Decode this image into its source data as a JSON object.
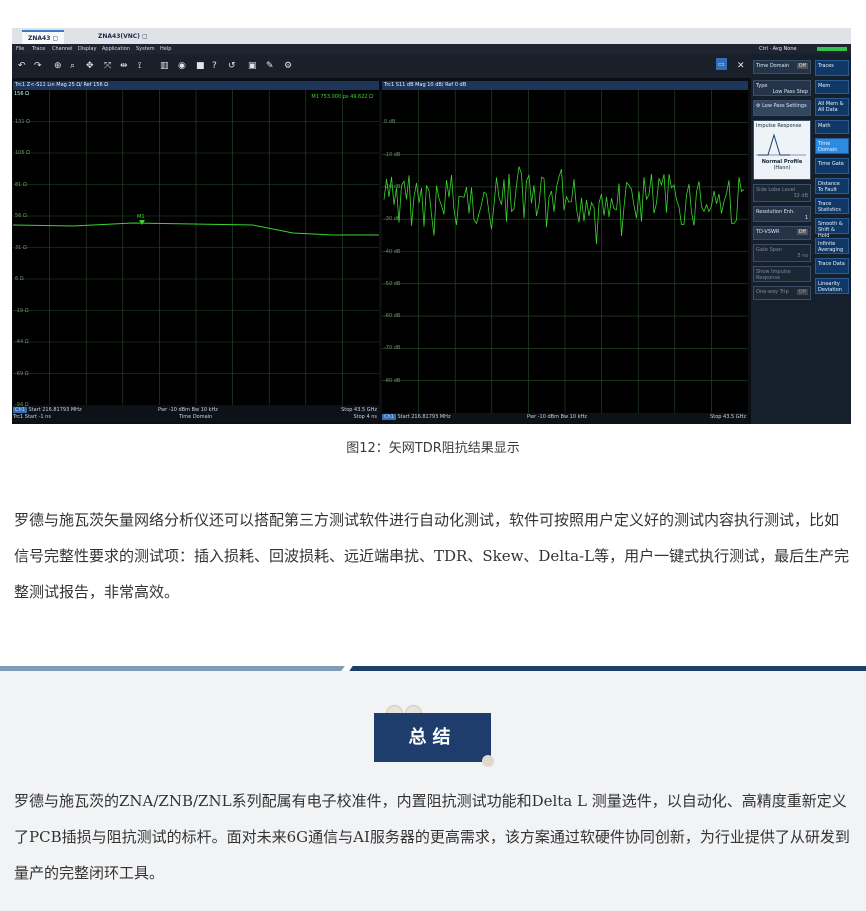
{
  "tabs": [
    {
      "label": "ZNA43"
    },
    {
      "label": "ZNA43(VNC)"
    }
  ],
  "menu": [
    "File",
    "Trace",
    "Channel",
    "Display",
    "Application",
    "System",
    "Help"
  ],
  "status_right": "Ctrl · Avg None",
  "left_trace": {
    "header": "Trc1  Z<-S11  Lin Mag  25 Ω/ Ref 156 Ω",
    "ref": "156 Ω",
    "marker": "M1  753.000  ps  49.622  Ω",
    "marker_label": "M1",
    "yticks": [
      "131 Ω",
      "106 Ω",
      "81 Ω",
      "56 Ω",
      "31 Ω",
      "6 Ω",
      "-19 Ω",
      "-44 Ω",
      "-69 Ω",
      "-94 Ω"
    ],
    "footer1_ch": "Ch1",
    "footer1": "Start  216.81793 MHz",
    "footer1_mid": "Pwr  -10 dBm  Bw  10 kHz",
    "footer1_end": "Stop  43.5 GHz",
    "footer2": "Trc1  Start  -1 ns",
    "footer2_mid": "Time  Domain",
    "footer2_end": "Stop  4 ns"
  },
  "right_trace": {
    "header": "Trc1  S11  dB Mag  10 dB/ Ref 0 dB",
    "yticks": [
      "0 dB",
      "-10 dB",
      "-20 dB",
      "-30 dB",
      "-40 dB",
      "-50 dB",
      "-60 dB",
      "-70 dB",
      "-80 dB"
    ],
    "footer_ch": "Ch1",
    "footer": "Start  216.81793 MHz",
    "footer_mid": "Pwr  -10 dBm  Bw  10 kHz",
    "footer_end": "Stop  43.5 GHz"
  },
  "side_panel": {
    "top_label": "Time Domain",
    "top_toggle": "Off",
    "type_label": "Type",
    "type_value": "Low Pass Step",
    "low_pass": "Low Pass Settings",
    "impulse": "Impulse Response",
    "profile": "Normal Profile",
    "profile_sub": "(Hann)",
    "side_lobe": "Side Lobe Level",
    "side_lobe_val": "32 dB",
    "resolution": "Resolution Enh.",
    "resolution_val": "1",
    "tdvswr": "TD-VSWR",
    "tdvswr_val": "Off",
    "gate_span": "Gate Span",
    "gate_span_val": "5 ns",
    "show_impulse": "Show Impulse Response",
    "oneway": "One-way Trip",
    "oneway_val": "Off",
    "buttons": [
      "Traces",
      "Mem",
      "All Mem & All Data",
      "Math",
      "Time Domain",
      "Time Gate",
      "Distance To Fault",
      "Trace Statistics",
      "Smooth & Shift & Hold",
      "Infinite Averaging",
      "Trace Data",
      "Linearity Deviation"
    ]
  },
  "caption": "图12：矢网TDR阻抗结果显示",
  "paragraph1": "罗德与施瓦茨矢量网络分析仪还可以搭配第三方测试软件进行自动化测试，软件可按照用户定义好的测试内容执行测试，比如信号完整性要求的测试项：插入损耗、回波损耗、远近端串扰、TDR、Skew、Delta-L等，用户一键式执行测试，最后生产完整测试报告，非常高效。",
  "summary_title": "总结",
  "paragraph2": "罗德与施瓦茨的ZNA/ZNB/ZNL系列配属有电子校准件，内置阻抗测试功能和Delta L 测量选件，以自动化、高精度重新定义了PCB插损与阻抗测试的标杆。面对未来6G通信与AI服务器的更高需求，该方案通过软硬件协同创新，为行业提供了从研发到量产的完整闭环工具。"
}
